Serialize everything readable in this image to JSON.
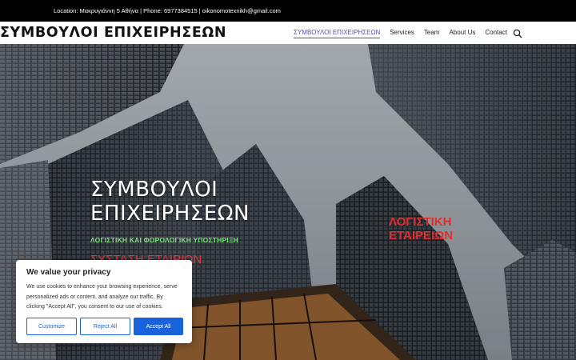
{
  "topbar": {
    "text": "Location: Μακρυγιάννη 5 Αθήνα | Phone: 6977384515 | oikonomotexnikh@gmail.com"
  },
  "header": {
    "logo": "ΣΥΜΒΟΥΛΟΙ ΕΠΙΧΕΙΡΗΣΕΩΝ",
    "nav": [
      {
        "label": "ΣΥΜΒΟΥΛΟΙ ΕΠΙΧΕΙΡΗΣΕΩΝ",
        "active": true
      },
      {
        "label": "Services",
        "active": false
      },
      {
        "label": "Team",
        "active": false
      },
      {
        "label": "About Us",
        "active": false
      },
      {
        "label": "Contact",
        "active": false
      }
    ],
    "search_icon": "search-icon"
  },
  "hero": {
    "title_line1": "ΣΥΜΒΟΥΛΟΙ",
    "title_line2": "ΕΠΙΧΕΙΡΗΣΕΩΝ",
    "subtitle": "ΛΟΓΙΣΤΙΚΗ ΚΑΙ ΦΟΡΟΛΟΓΙΚΗ ΥΠΟΣΤΗΡΙΞΗ",
    "red_left": "ΣΥΣΤΑΣΗ ΕΤΑΙΡΙΩΝ",
    "red_right_line1": "ΛΟΓΙΣΤΙΚΗ",
    "red_right_line2": "ΕΤΑΙΡΕΙΩΝ"
  },
  "cookie": {
    "title": "We value your privacy",
    "text": "We use cookies to enhance your browsing experience, serve personalized ads or content, and analyze our traffic. By clicking \"Accept All\", you consent to our use of cookies.",
    "customize": "Customize",
    "reject": "Reject All",
    "accept": "Accept All"
  },
  "colors": {
    "accent": "#1863dc",
    "nav_active": "#5b4ba6",
    "hero_subtitle": "#7ee07e",
    "hero_red": "#e02d2d"
  }
}
